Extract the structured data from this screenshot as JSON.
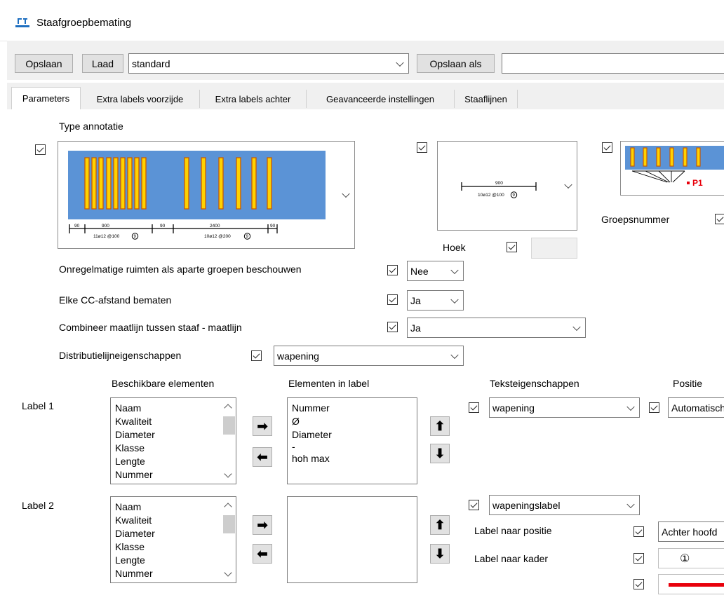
{
  "window": {
    "title": "Staafgroepbemating",
    "icon": "app-icon"
  },
  "toolbar": {
    "save_label": "Opslaan",
    "load_label": "Laad",
    "preset_value": "standard",
    "save_as_label": "Opslaan als",
    "save_as_value": ""
  },
  "tabs": [
    {
      "label": "Parameters",
      "active": true
    },
    {
      "label": "Extra labels voorzijde"
    },
    {
      "label": "Extra labels achter"
    },
    {
      "label": "Geavanceerde instellingen"
    },
    {
      "label": "Staaflijnen"
    }
  ],
  "annotation": {
    "heading": "Type annotatie",
    "preview1": {
      "dim_top1": "90",
      "dim_top2": "900",
      "dim_top3": "90",
      "dim_top4": "2400",
      "dim_top5": "90",
      "label1": "11ø12 @100",
      "label2": "10ø12 @200",
      "circle_label": "9"
    },
    "preview2": {
      "dim": "900",
      "label": "10ø12 @100",
      "circle_label": "9"
    },
    "preview3": {
      "label": "P1"
    },
    "hoek_label": "Hoek",
    "hoek_value": "",
    "groepsnummer_label": "Groepsnummer"
  },
  "options": {
    "irregular_label": "Onregelmatige ruimten als aparte groepen beschouwen",
    "irregular_value": "Nee",
    "cc_label": "Elke CC-afstand bematen",
    "cc_value": "Ja",
    "combine_label": "Combineer maatlijn tussen staaf - maatlijn",
    "combine_value": "Ja",
    "distribution_label": "Distributielijneigenschappen",
    "distribution_value": "wapening"
  },
  "columns": {
    "available": "Beschikbare elementen",
    "in_label": "Elementen in label",
    "text_props": "Teksteigenschappen",
    "position": "Positie"
  },
  "label1": {
    "label": "Label 1",
    "available": [
      "Naam",
      "Kwaliteit",
      "Diameter",
      "Klasse",
      "Lengte",
      "Nummer"
    ],
    "in_label": [
      "Nummer",
      "Ø",
      "Diameter",
      "-",
      "hoh max"
    ],
    "text_props": "wapening",
    "position": "Automatisch"
  },
  "label2": {
    "label": "Label 2",
    "available": [
      "Naam",
      "Kwaliteit",
      "Diameter",
      "Klasse",
      "Lengte",
      "Nummer"
    ],
    "in_label": [],
    "text_props": "wapeningslabel",
    "to_position_label": "Label naar positie",
    "to_position_value": "Achter hoofd",
    "to_frame_label": "Label naar kader",
    "frame_symbol": "①",
    "line_color": "#e8000b"
  },
  "colors": {
    "rebar_bg": "#5b93d6",
    "rebar_bar": "#ffd200",
    "rebar_edge": "#c85a00",
    "accent_red": "#e8000b"
  }
}
